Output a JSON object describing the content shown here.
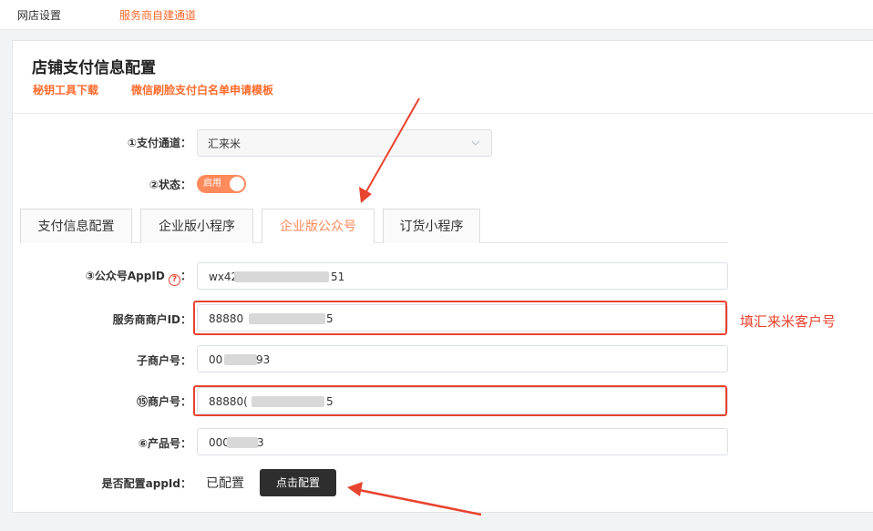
{
  "topnav": {
    "item1": "网店设置",
    "item2": "服务商自建通道"
  },
  "header": {
    "title": "店铺支付信息配置",
    "link1": "秘钥工具下载",
    "link2": "微信刷脸支付白名单申请模板"
  },
  "form": {
    "channel_label": "①支付通道：",
    "channel_value": "汇来米",
    "status_label": "②状态：",
    "status_switch": "启用",
    "status_on": true
  },
  "tabs": [
    "支付信息配置",
    "企业版小程序",
    "企业版公众号",
    "订货小程序"
  ],
  "active_tab": 2,
  "fields": {
    "appid_label": "③公众号AppID",
    "appid_value_start": "wx42",
    "appid_value_end": "51",
    "sp_merchant_label": "服务商商户ID：",
    "sp_merchant_start": "88880",
    "sp_merchant_end": "5",
    "sub_merchant_label": "子商户号：",
    "sub_merchant_start": "00",
    "sub_merchant_end": "93",
    "merchant_label": "⑮商户号：",
    "merchant_start": "88880(",
    "merchant_end": "5",
    "product_label": "⑥产品号：",
    "product_start": "000",
    "product_end": "3",
    "config_label": "是否配置appId：",
    "config_status": "已配置",
    "config_button": "点击配置"
  },
  "annotation": "填汇来米客户号",
  "colors": {
    "accent": "#ff6a2b",
    "highlight": "#e8432e",
    "button": "#2e2e2e"
  }
}
